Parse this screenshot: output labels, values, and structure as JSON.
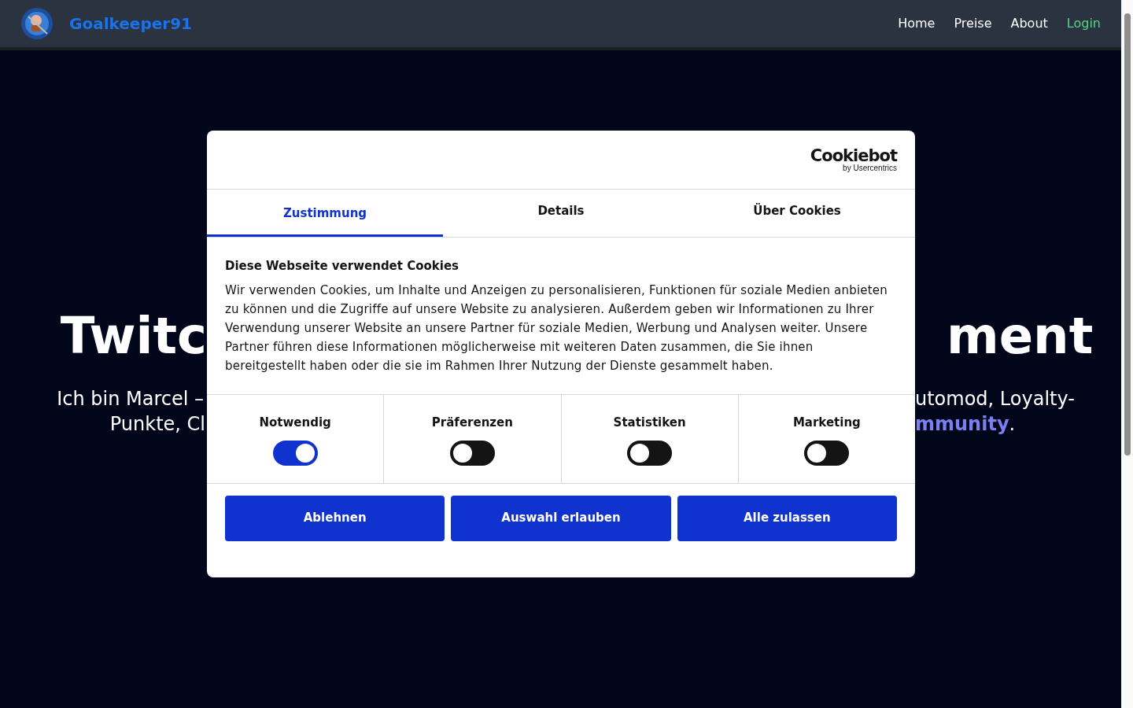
{
  "navbar": {
    "brand": "Goalkeeper91",
    "links": [
      {
        "label": "Home",
        "selected": false
      },
      {
        "label": "Preise",
        "selected": false
      },
      {
        "label": "About",
        "selected": false
      },
      {
        "label": "Login",
        "selected": true
      }
    ]
  },
  "hero": {
    "heading_left": "Twitc",
    "heading_right": "ment",
    "subtitle_left": [
      "Ich bin Marcel –",
      "Punkte, Cl"
    ],
    "subtitle_right": [
      "utomod, Loyalty-",
      "**mmunity**."
    ]
  },
  "consent_dialog": {
    "logo": "Cookiebot",
    "logo_sub": "by Usercentrics",
    "tabs": [
      {
        "label": "Zustimmung",
        "selected": true
      },
      {
        "label": "Details",
        "selected": false
      },
      {
        "label": "Über Cookies",
        "selected": false
      }
    ],
    "title": "Diese Webseite verwendet Cookies",
    "body": "Wir verwenden Cookies, um Inhalte und Anzeigen zu personalisieren, Funktionen für soziale Medien anbieten zu können und die Zugriffe auf unsere Website zu analysieren. Außerdem geben wir Informationen zu Ihrer Verwendung unserer Website an unsere Partner für soziale Medien, Werbung und Analysen weiter. Unsere Partner führen diese Informationen möglicherweise mit weiteren Daten zusammen, die Sie ihnen bereitgestellt haben oder die sie im Rahmen Ihrer Nutzung der Dienste gesammelt haben.",
    "categories": [
      {
        "label": "Notwendig",
        "on": true
      },
      {
        "label": "Präferenzen",
        "on": false
      },
      {
        "label": "Statistiken",
        "on": false
      },
      {
        "label": "Marketing",
        "on": false
      }
    ],
    "buttons": [
      "Ablehnen",
      "Auswahl erlauben",
      "Alle zulassen"
    ]
  }
}
